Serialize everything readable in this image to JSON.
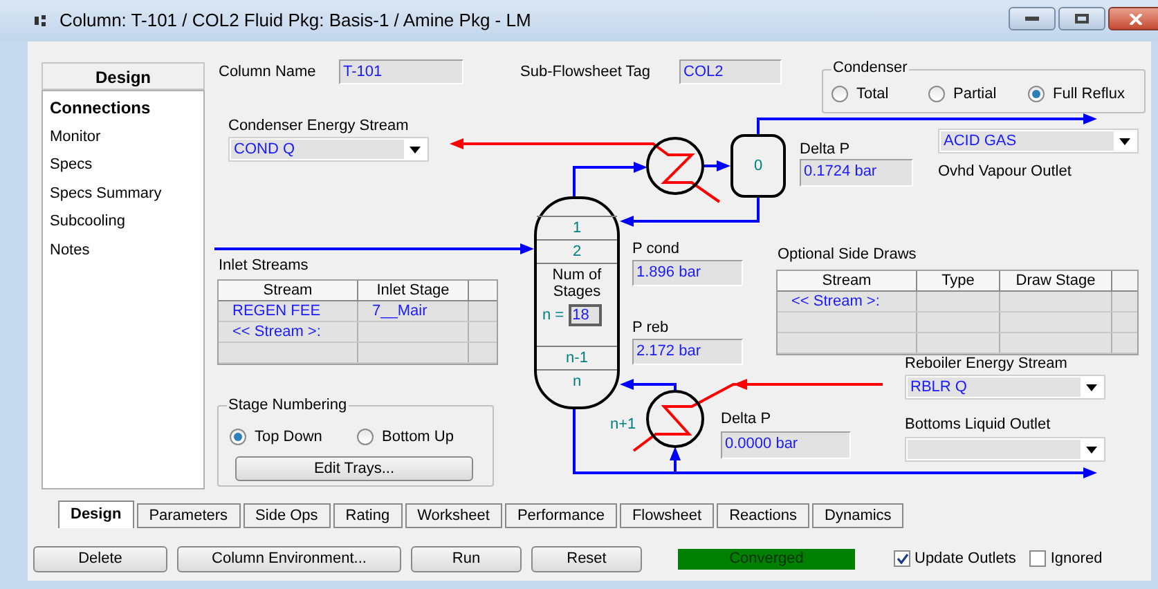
{
  "window": {
    "title": "Column: T-101 / COL2  Fluid Pkg: Basis-1 / Amine Pkg - LM"
  },
  "sidebar": {
    "title": "Design",
    "items": [
      {
        "label": "Connections",
        "selected": true
      },
      {
        "label": "Monitor",
        "selected": false
      },
      {
        "label": "Specs",
        "selected": false
      },
      {
        "label": "Specs Summary",
        "selected": false
      },
      {
        "label": "Subcooling",
        "selected": false
      },
      {
        "label": "Notes",
        "selected": false
      }
    ]
  },
  "column_name": {
    "label": "Column Name",
    "value": "T-101"
  },
  "subflowsheet_tag": {
    "label": "Sub-Flowsheet Tag",
    "value": "COL2"
  },
  "condenser": {
    "title": "Condenser",
    "options": [
      {
        "label": "Total",
        "selected": false
      },
      {
        "label": "Partial",
        "selected": false
      },
      {
        "label": "Full Reflux",
        "selected": true
      }
    ]
  },
  "condenser_energy_stream": {
    "label": "Condenser Energy Stream",
    "value": "COND Q"
  },
  "condenser_drum": {
    "stage": "0"
  },
  "condenser_delta_p": {
    "label": "Delta P",
    "value": "0.1724 bar"
  },
  "ovhd_vapour_outlet": {
    "label": "Ovhd Vapour Outlet",
    "value": "ACID GAS"
  },
  "column": {
    "top_stages": [
      "1",
      "2"
    ],
    "num_stages_label": "Num of Stages",
    "n_label": "n =",
    "n_value": "18",
    "bottom_stages": [
      "n-1",
      "n"
    ],
    "reboiler_stage": "n+1"
  },
  "p_cond": {
    "label": "P cond",
    "value": "1.896 bar"
  },
  "p_reb": {
    "label": "P reb",
    "value": "2.172 bar"
  },
  "inlet_streams": {
    "title": "Inlet Streams",
    "columns": [
      "Stream",
      "Inlet Stage"
    ],
    "rows": [
      {
        "stream": "REGEN FEE",
        "stage": "7__Mair"
      },
      {
        "stream": "<< Stream >:"
      }
    ]
  },
  "side_draws": {
    "title": "Optional Side Draws",
    "columns": [
      "Stream",
      "Type",
      "Draw Stage"
    ],
    "rows": [
      {
        "stream": "<< Stream >:"
      }
    ]
  },
  "reboiler_energy_stream": {
    "label": "Reboiler Energy Stream",
    "value": "RBLR Q"
  },
  "reboiler_delta_p": {
    "label": "Delta P",
    "value": "0.0000 bar"
  },
  "bottoms_liquid_outlet": {
    "label": "Bottoms Liquid Outlet"
  },
  "stage_numbering": {
    "title": "Stage Numbering",
    "options": [
      {
        "label": "Top Down",
        "selected": true
      },
      {
        "label": "Bottom Up",
        "selected": false
      }
    ],
    "button": "Edit Trays..."
  },
  "tabs": [
    {
      "label": "Design",
      "selected": true
    },
    {
      "label": "Parameters",
      "selected": false
    },
    {
      "label": "Side Ops",
      "selected": false
    },
    {
      "label": "Rating",
      "selected": false
    },
    {
      "label": "Worksheet",
      "selected": false
    },
    {
      "label": "Performance",
      "selected": false
    },
    {
      "label": "Flowsheet",
      "selected": false
    },
    {
      "label": "Reactions",
      "selected": false
    },
    {
      "label": "Dynamics",
      "selected": false
    }
  ],
  "buttons": [
    "Delete",
    "Column Environment...",
    "Run",
    "Reset"
  ],
  "status": {
    "text": "Converged"
  },
  "checkboxes": [
    {
      "label": "Update Outlets",
      "checked": true
    },
    {
      "label": "Ignored",
      "checked": false
    }
  ]
}
